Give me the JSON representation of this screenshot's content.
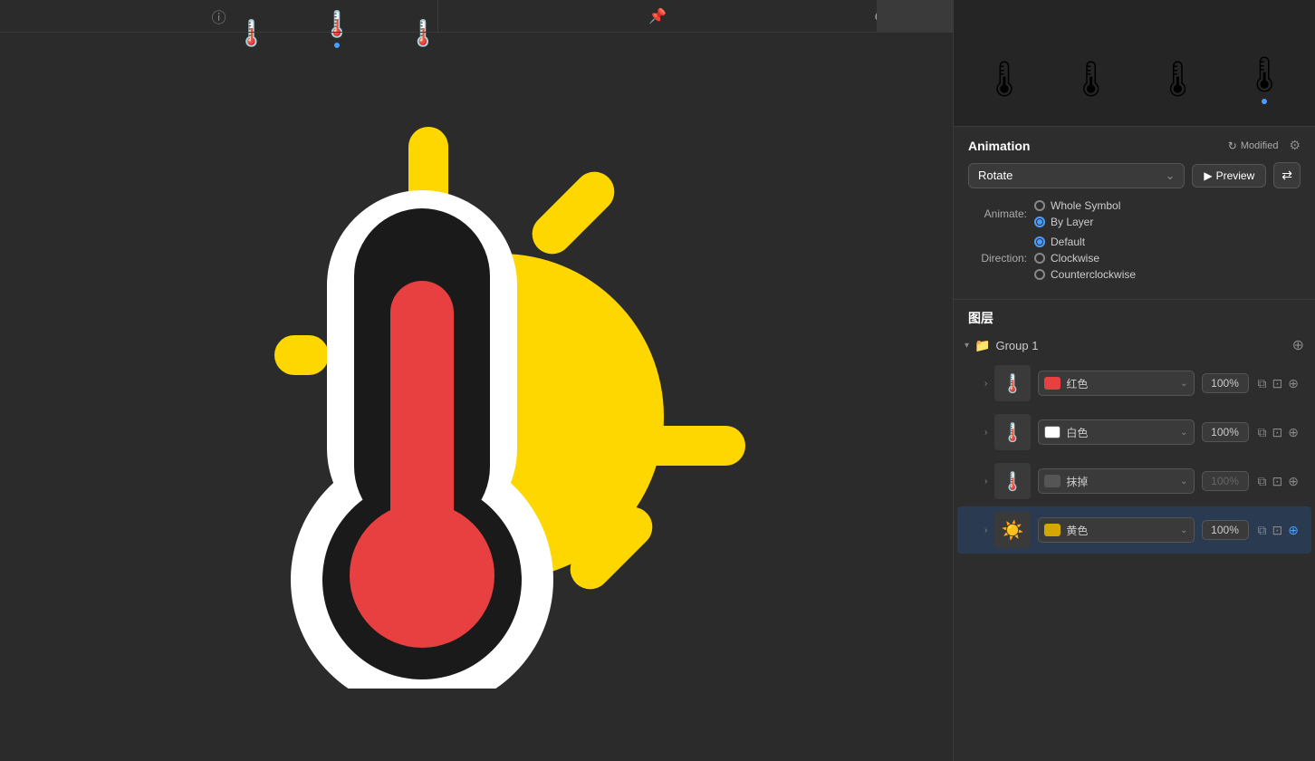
{
  "canvas": {
    "toolbar_icons": [
      "⊕",
      "⚲",
      "○"
    ],
    "frame_previews": [
      {
        "emoji": "🌡️",
        "has_dot": false
      },
      {
        "emoji": "🌡️",
        "has_dot": true
      },
      {
        "emoji": "🌡️",
        "has_dot": false
      }
    ]
  },
  "tabs": [
    {
      "id": "info",
      "icon": "ℹ",
      "active": false
    },
    {
      "id": "pin",
      "icon": "📌",
      "active": false
    },
    {
      "id": "play",
      "icon": "▶",
      "active": true
    }
  ],
  "preview_frames": [
    {
      "emoji": "🌡️",
      "has_dot": false
    },
    {
      "emoji": "🌡️",
      "has_dot": false
    },
    {
      "emoji": "🌡️",
      "has_dot": false
    },
    {
      "emoji": "🌡️",
      "has_dot": true
    }
  ],
  "animation": {
    "section_title": "Animation",
    "modified_label": "Modified",
    "type_dropdown": "Rotate",
    "preview_button": "Preview",
    "animate_label": "Animate:",
    "animate_options": [
      {
        "label": "Whole Symbol",
        "selected": false
      },
      {
        "label": "By Layer",
        "selected": true
      }
    ],
    "direction_label": "Direction:",
    "direction_options": [
      {
        "label": "Default",
        "selected": true
      },
      {
        "label": "Clockwise",
        "selected": false
      },
      {
        "label": "Counterclockwise",
        "selected": false
      }
    ]
  },
  "layers": {
    "section_title": "图层",
    "group_name": "Group 1",
    "items": [
      {
        "id": "layer-red",
        "thumb_emoji": "🌡️",
        "color_name": "红色",
        "color_hex": "#e84040",
        "opacity": "100%",
        "selected": false,
        "expanded": false
      },
      {
        "id": "layer-white",
        "thumb_emoji": "🌡️",
        "color_name": "白色",
        "color_hex": "#ffffff",
        "opacity": "100%",
        "selected": false,
        "expanded": false
      },
      {
        "id": "layer-erase",
        "thumb_emoji": "🌡️",
        "color_name": "抹掉",
        "color_hex": "#555555",
        "opacity": "100%",
        "opacity_muted": true,
        "selected": false,
        "expanded": false
      },
      {
        "id": "layer-yellow",
        "thumb_emoji": "☀️",
        "color_name": "黄色",
        "color_hex": "#d4a800",
        "opacity": "100%",
        "selected": true,
        "expanded": false
      }
    ]
  }
}
